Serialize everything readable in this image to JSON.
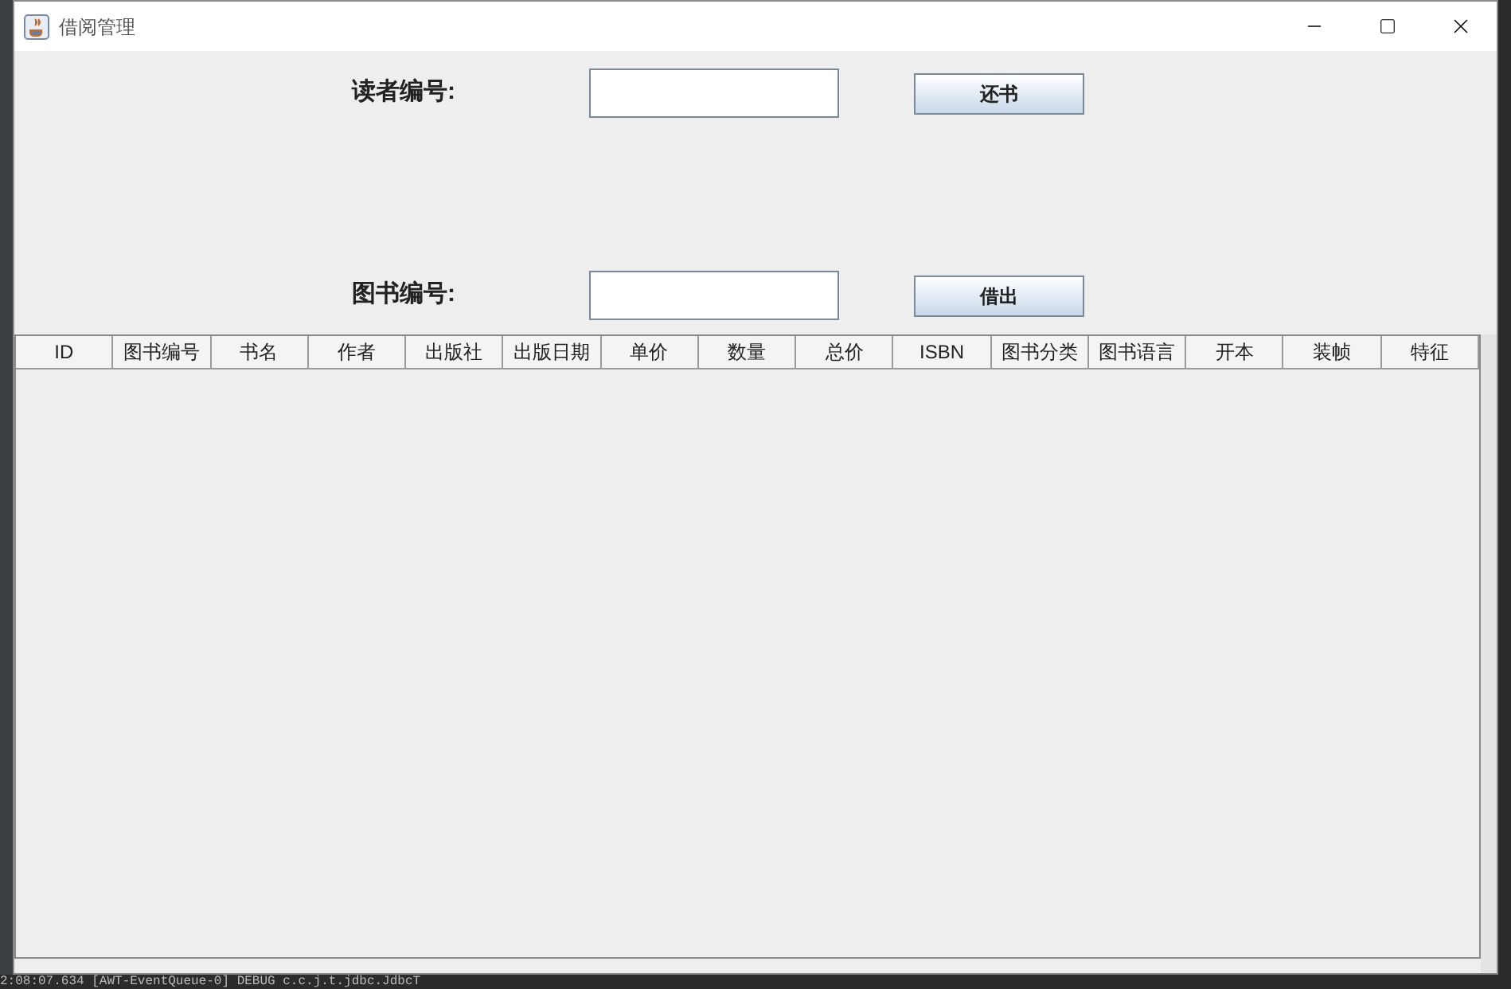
{
  "window": {
    "title": "借阅管理"
  },
  "form": [
    {
      "label": "读者编号:",
      "button": "还书"
    },
    {
      "label": "图书编号:",
      "button": "借出"
    }
  ],
  "table": {
    "columns": [
      "ID",
      "图书编号",
      "书名",
      "作者",
      "出版社",
      "出版日期",
      "单价",
      "数量",
      "总价",
      "ISBN",
      "图书分类",
      "图书语言",
      "开本",
      "装帧",
      "特征"
    ]
  },
  "console": {
    "line": "2:08:07.634 [AWT-EventQueue-0] DEBUG c.c.j.t.jdbc.JdbcT"
  }
}
